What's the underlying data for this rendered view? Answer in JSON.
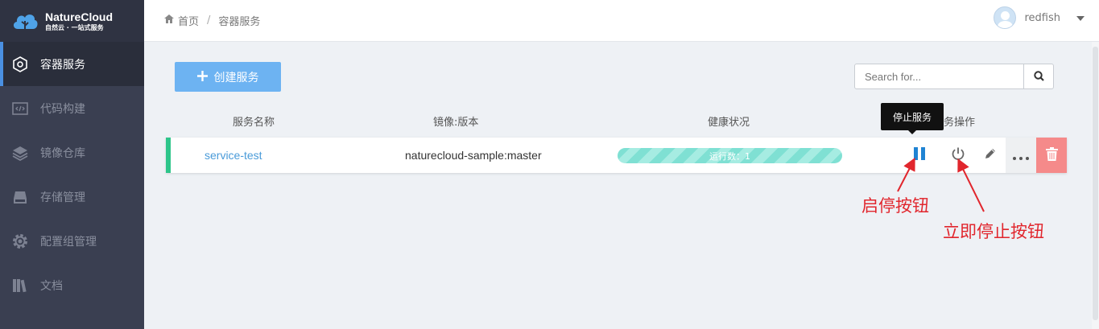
{
  "app": {
    "name": "NatureCloud",
    "tagline": "自然云 · 一站式服务"
  },
  "sidebar": {
    "items": [
      {
        "label": "容器服务",
        "icon": "hexagon-icon",
        "active": true
      },
      {
        "label": "代码构建",
        "icon": "code-icon",
        "active": false
      },
      {
        "label": "镜像仓库",
        "icon": "layers-icon",
        "active": false
      },
      {
        "label": "存储管理",
        "icon": "storage-icon",
        "active": false
      },
      {
        "label": "配置组管理",
        "icon": "gear-icon",
        "active": false
      },
      {
        "label": "文档",
        "icon": "books-icon",
        "active": false
      }
    ]
  },
  "header": {
    "breadcrumb": {
      "home": "首页",
      "current": "容器服务"
    },
    "user": {
      "name": "redfish"
    }
  },
  "toolbar": {
    "create_label": "创建服务",
    "search_placeholder": "Search for..."
  },
  "table": {
    "headers": {
      "name": "服务名称",
      "image": "镜像:版本",
      "health": "健康状况",
      "actions": "服务操作"
    },
    "rows": [
      {
        "name": "service-test",
        "image": "naturecloud-sample:master",
        "health": "运行数：1"
      }
    ]
  },
  "tooltip": {
    "text": "停止服务"
  },
  "annotations": {
    "pause": "启停按钮",
    "stop": "立即停止按钮"
  },
  "colors": {
    "sidebar": "#3a3f51",
    "accent": "#4a90e2",
    "create_button": "#6db3f2",
    "healthy": "#2dc58a",
    "delete": "#f58a8a",
    "annotation": "#e1262d"
  }
}
